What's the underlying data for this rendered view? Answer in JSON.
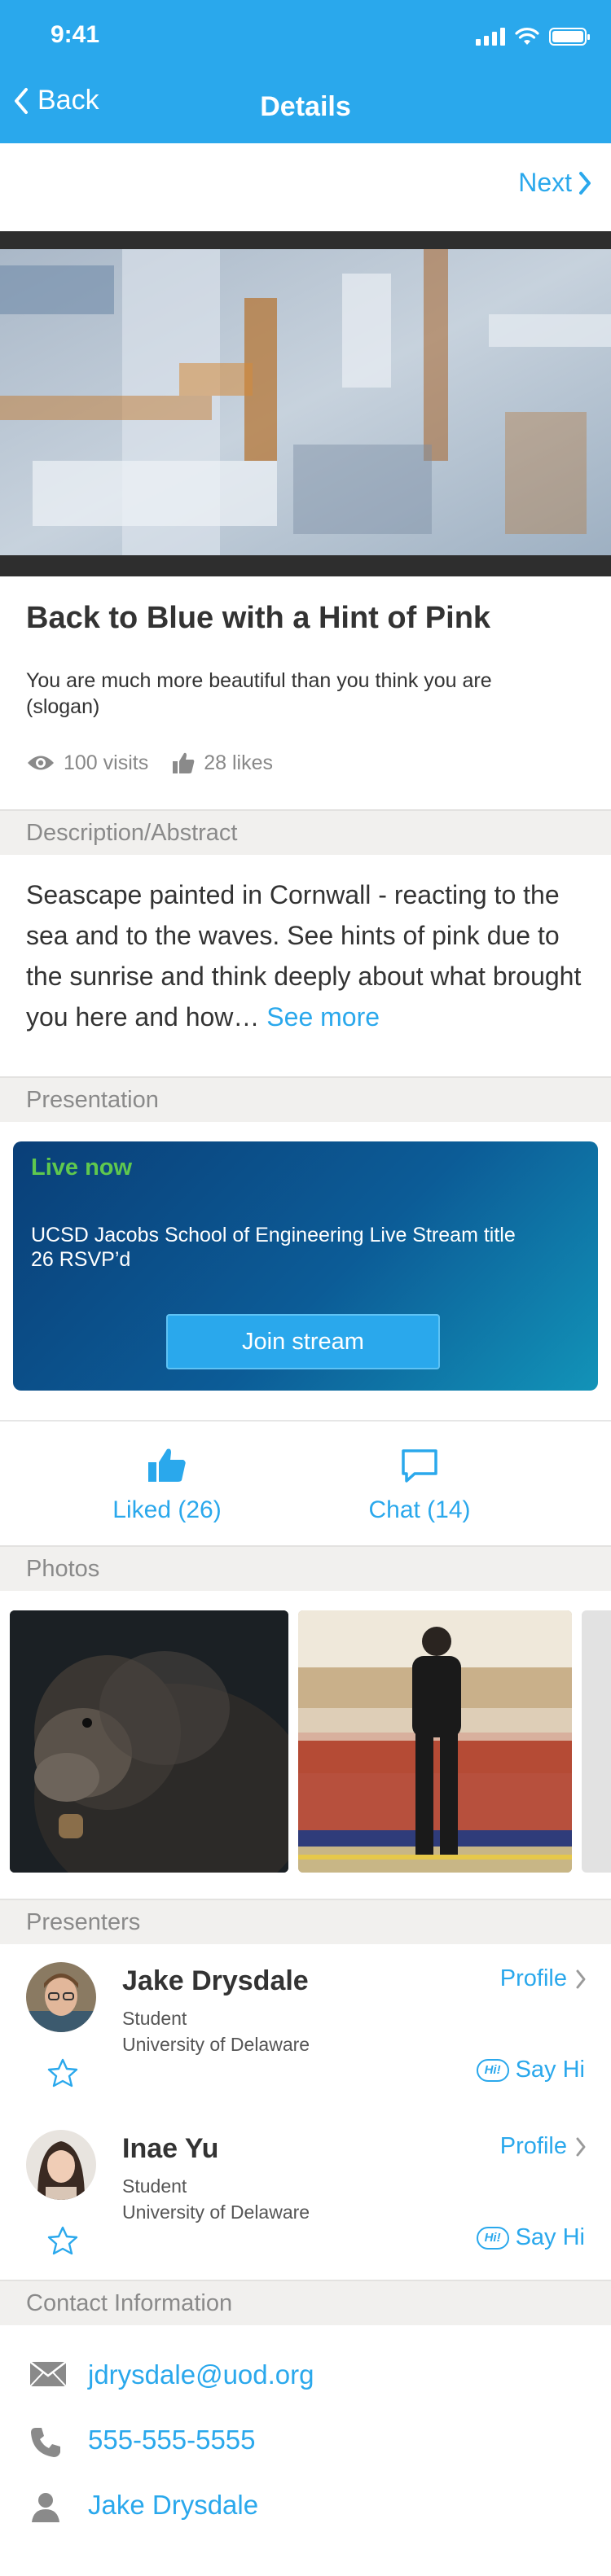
{
  "status_bar": {
    "time": "9:41"
  },
  "nav": {
    "back_label": "Back",
    "title": "Details",
    "next_label": "Next"
  },
  "artwork": {
    "title": "Back to Blue with a Hint of Pink",
    "slogan": "You are much more beautiful than you think you are (slogan)",
    "visits": "100 visits",
    "likes": "28 likes"
  },
  "sections": {
    "description": "Description/Abstract",
    "presentation": "Presentation",
    "photos": "Photos",
    "presenters": "Presenters",
    "contact": "Contact Information"
  },
  "description": {
    "text": "Seascape painted in Cornwall - reacting to the sea and to the waves. See hints of pink due to the sunrise and think deeply about what brought you here and how…",
    "see_more": "See more"
  },
  "presentation": {
    "status": "Live now",
    "stream_title": "UCSD Jacobs School of Engineering Live Stream title",
    "rsvp": "26 RSVP’d",
    "join_label": "Join stream"
  },
  "actions": {
    "liked": "Liked (26)",
    "chat": "Chat (14)"
  },
  "photos": [
    {
      "icon": "gorilla-photo"
    },
    {
      "icon": "train-platform-photo"
    },
    {
      "icon": "photo-partial"
    }
  ],
  "presenters": [
    {
      "name": "Jake Drysdale",
      "role": "Student",
      "org": "University of Delaware",
      "profile": "Profile",
      "say_hi": "Say Hi",
      "hi_badge": "Hi!"
    },
    {
      "name": "Inae Yu",
      "role": "Student",
      "org": "University of Delaware",
      "profile": "Profile",
      "say_hi": "Say Hi",
      "hi_badge": "Hi!"
    }
  ],
  "contact": {
    "email": "jdrysdale@uod.org",
    "phone": "555-555-5555",
    "person": "Jake Drysdale"
  },
  "colors": {
    "accent": "#2aa8ec",
    "live": "#5fc84e",
    "section_bg": "#f1f0ee"
  }
}
